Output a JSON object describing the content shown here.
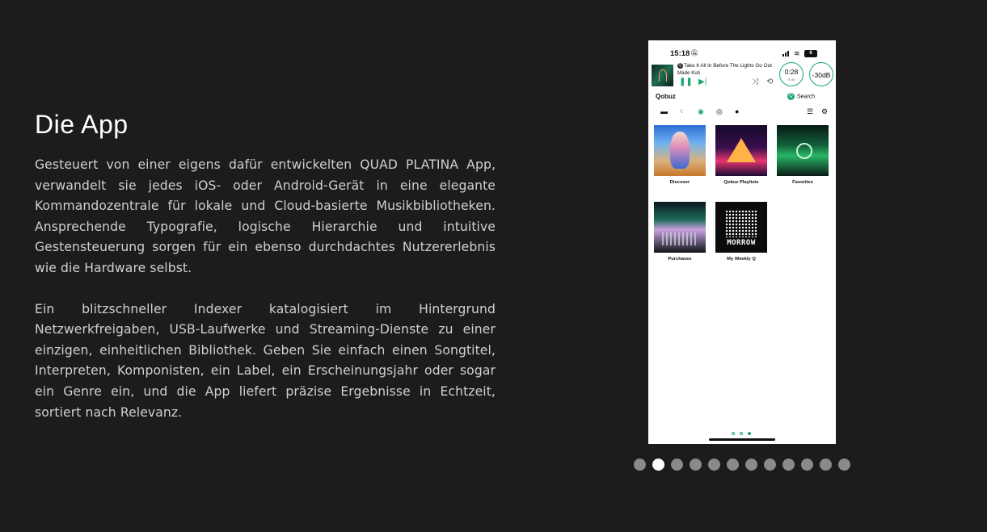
{
  "section": {
    "heading": "Die App",
    "paragraphs": [
      "Gesteuert von einer eigens dafür entwickelten QUAD PLATINA App, verwandelt sie jedes iOS- oder Android-Gerät in eine elegante Kommandozentrale für lokale und Cloud-basierte Musikbibliotheken. Ansprechende Typografie, logische Hierarchie und intuitive Gestensteuerung sorgen für ein ebenso durchdachtes Nutzererlebnis wie die Hardware selbst.",
      "Ein blitzschneller Indexer katalogisiert im Hintergrund Netzwerkfreigaben, USB-Laufwerke und Streaming-Dienste zu einer einzigen, einheitlichen Bibliothek. Geben Sie einfach einen Songtitel, Interpreten, Komponisten, ein Label, ein Erscheinungsjahr oder sogar ein Genre ein, und die App liefert präzise Ergebnisse in Echtzeit, sortiert nach Relevanz."
    ]
  },
  "phone": {
    "status": {
      "time": "15:18",
      "battery": "6"
    },
    "now_playing": {
      "title": "Take It All In Before The Lights Go Out",
      "artist": "Made Kuti",
      "elapsed": "0:28",
      "remaining": "/5:40",
      "volume": "-30dB"
    },
    "service": {
      "name": "Qobuz",
      "search_label": "Search"
    },
    "tiles": [
      {
        "label": "Discover"
      },
      {
        "label": "Qobuz Playlists"
      },
      {
        "label": "Favorites"
      },
      {
        "label": "Purchases"
      },
      {
        "label": "My Weekly Q"
      }
    ],
    "weekly_cover_text": "MORROW",
    "page_indicator": {
      "count": 3,
      "active": 3
    }
  },
  "carousel": {
    "count": 12,
    "active": 2
  },
  "colors": {
    "background": "#1c1c1c",
    "accent": "#1aa76e",
    "dot": "#8a8a8a",
    "dot_active": "#ffffff"
  }
}
